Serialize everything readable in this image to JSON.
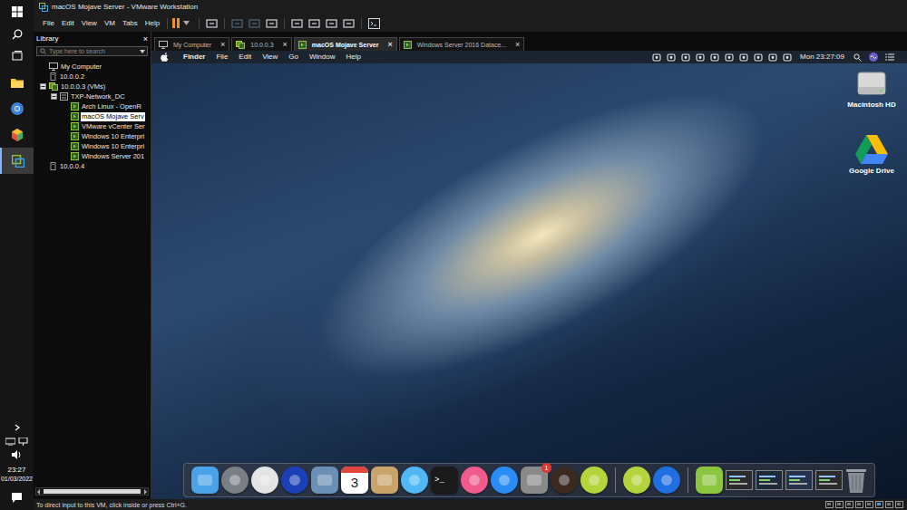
{
  "taskbar": {
    "apps": [
      {
        "kind": "explorer",
        "selected": false
      },
      {
        "kind": "chrome",
        "selected": false
      },
      {
        "kind": "cube",
        "selected": false
      },
      {
        "kind": "vmware",
        "selected": true
      }
    ],
    "time": "23:27",
    "date": "01/03/2022"
  },
  "window": {
    "title": "macOS Mojave Server - VMware Workstation"
  },
  "menu": [
    "File",
    "Edit",
    "View",
    "VM",
    "Tabs",
    "Help"
  ],
  "library": {
    "title": "Library",
    "close": "×",
    "search_placeholder": "Type here to search",
    "tree": [
      {
        "label": "My Computer",
        "kind": "computer",
        "selected": false
      },
      {
        "label": "10.0.0.2",
        "kind": "host",
        "selected": false
      },
      {
        "label": "10.0.0.3 (VMs)",
        "kind": "server",
        "selected": false,
        "expanded": true,
        "children": [
          {
            "label": "TXP-Network_DC",
            "kind": "datacenter",
            "selected": false,
            "expanded": true,
            "children": [
              {
                "label": "Arch Linux - OpenR",
                "kind": "vm",
                "selected": false
              },
              {
                "label": "macOS Mojave Serv",
                "kind": "vm",
                "selected": true
              },
              {
                "label": "VMware vCenter Ser",
                "kind": "vm",
                "selected": false
              },
              {
                "label": "Windows 10 Enterpri",
                "kind": "vm",
                "selected": false
              },
              {
                "label": "Windows 10 Enterpri",
                "kind": "vm",
                "selected": false
              },
              {
                "label": "Windows Server 201",
                "kind": "vm",
                "selected": false
              }
            ]
          }
        ]
      },
      {
        "label": "10.0.0.4",
        "kind": "host",
        "selected": false
      }
    ]
  },
  "tabs": [
    {
      "label": "My Computer",
      "kind": "computer",
      "selected": false,
      "close": "×"
    },
    {
      "label": "10.0.0.3",
      "kind": "server",
      "selected": false,
      "close": "×"
    },
    {
      "label": "macOS Mojave Server",
      "kind": "vm",
      "selected": true,
      "close": "×"
    },
    {
      "label": "Windows Server 2016 Datace...",
      "kind": "vm",
      "selected": false,
      "close": "×"
    }
  ],
  "mac_menubar": {
    "menus": [
      "Finder",
      "File",
      "Edit",
      "View",
      "Go",
      "Window",
      "Help"
    ],
    "clock": "Mon 23:27:09"
  },
  "desktop_icons": [
    {
      "label": "Macintosh HD",
      "kind": "disk"
    },
    {
      "label": "Google Drive",
      "kind": "drive"
    }
  ],
  "dock": {
    "groups": [
      [
        {
          "kind": "app",
          "color": "#4aa3e8"
        },
        {
          "kind": "round",
          "color": "#7a7f86"
        },
        {
          "kind": "round",
          "color": "#e4e4e4"
        },
        {
          "kind": "round",
          "color": "#1b3fb5"
        },
        {
          "kind": "app",
          "color": "#6b8fb5"
        },
        {
          "kind": "calendar",
          "color": "#ffffff",
          "text": "3"
        },
        {
          "kind": "app",
          "color": "#c9a46a"
        },
        {
          "kind": "round",
          "color": "#4fb8f5"
        },
        {
          "kind": "terminal",
          "color": "#1a1a1a",
          "text": ">_"
        },
        {
          "kind": "round",
          "color": "#f05a8c"
        },
        {
          "kind": "round",
          "color": "#2a8cf5"
        },
        {
          "kind": "app",
          "color": "#8a8a8a",
          "badge": "1"
        },
        {
          "kind": "round",
          "color": "#3a2a20"
        },
        {
          "kind": "round",
          "color": "#b5d33a"
        }
      ],
      [
        {
          "kind": "round",
          "color": "#b5d33a"
        },
        {
          "kind": "round",
          "color": "#1f6fe0"
        }
      ],
      [
        {
          "kind": "app",
          "color": "#8cc63f"
        },
        {
          "kind": "window",
          "color": "#2b2b2b"
        },
        {
          "kind": "window",
          "color": "#1e2a3a"
        },
        {
          "kind": "window",
          "color": "#26324a"
        },
        {
          "kind": "window",
          "color": "#2b2b2b"
        },
        {
          "kind": "trash",
          "color": "#9aa0a6"
        }
      ]
    ]
  },
  "status_bar": {
    "text": "To direct input to this VM, click inside or press Ctrl+G."
  }
}
